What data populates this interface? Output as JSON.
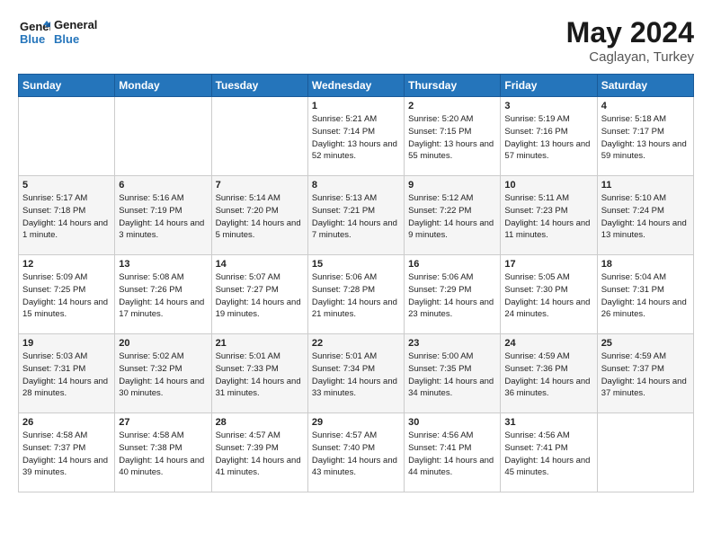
{
  "logo": {
    "line1": "General",
    "line2": "Blue"
  },
  "title": "May 2024",
  "location": "Caglayan, Turkey",
  "days_of_week": [
    "Sunday",
    "Monday",
    "Tuesday",
    "Wednesday",
    "Thursday",
    "Friday",
    "Saturday"
  ],
  "weeks": [
    [
      {
        "num": "",
        "info": ""
      },
      {
        "num": "",
        "info": ""
      },
      {
        "num": "",
        "info": ""
      },
      {
        "num": "1",
        "info": "Sunrise: 5:21 AM\nSunset: 7:14 PM\nDaylight: 13 hours\nand 52 minutes."
      },
      {
        "num": "2",
        "info": "Sunrise: 5:20 AM\nSunset: 7:15 PM\nDaylight: 13 hours\nand 55 minutes."
      },
      {
        "num": "3",
        "info": "Sunrise: 5:19 AM\nSunset: 7:16 PM\nDaylight: 13 hours\nand 57 minutes."
      },
      {
        "num": "4",
        "info": "Sunrise: 5:18 AM\nSunset: 7:17 PM\nDaylight: 13 hours\nand 59 minutes."
      }
    ],
    [
      {
        "num": "5",
        "info": "Sunrise: 5:17 AM\nSunset: 7:18 PM\nDaylight: 14 hours\nand 1 minute."
      },
      {
        "num": "6",
        "info": "Sunrise: 5:16 AM\nSunset: 7:19 PM\nDaylight: 14 hours\nand 3 minutes."
      },
      {
        "num": "7",
        "info": "Sunrise: 5:14 AM\nSunset: 7:20 PM\nDaylight: 14 hours\nand 5 minutes."
      },
      {
        "num": "8",
        "info": "Sunrise: 5:13 AM\nSunset: 7:21 PM\nDaylight: 14 hours\nand 7 minutes."
      },
      {
        "num": "9",
        "info": "Sunrise: 5:12 AM\nSunset: 7:22 PM\nDaylight: 14 hours\nand 9 minutes."
      },
      {
        "num": "10",
        "info": "Sunrise: 5:11 AM\nSunset: 7:23 PM\nDaylight: 14 hours\nand 11 minutes."
      },
      {
        "num": "11",
        "info": "Sunrise: 5:10 AM\nSunset: 7:24 PM\nDaylight: 14 hours\nand 13 minutes."
      }
    ],
    [
      {
        "num": "12",
        "info": "Sunrise: 5:09 AM\nSunset: 7:25 PM\nDaylight: 14 hours\nand 15 minutes."
      },
      {
        "num": "13",
        "info": "Sunrise: 5:08 AM\nSunset: 7:26 PM\nDaylight: 14 hours\nand 17 minutes."
      },
      {
        "num": "14",
        "info": "Sunrise: 5:07 AM\nSunset: 7:27 PM\nDaylight: 14 hours\nand 19 minutes."
      },
      {
        "num": "15",
        "info": "Sunrise: 5:06 AM\nSunset: 7:28 PM\nDaylight: 14 hours\nand 21 minutes."
      },
      {
        "num": "16",
        "info": "Sunrise: 5:06 AM\nSunset: 7:29 PM\nDaylight: 14 hours\nand 23 minutes."
      },
      {
        "num": "17",
        "info": "Sunrise: 5:05 AM\nSunset: 7:30 PM\nDaylight: 14 hours\nand 24 minutes."
      },
      {
        "num": "18",
        "info": "Sunrise: 5:04 AM\nSunset: 7:31 PM\nDaylight: 14 hours\nand 26 minutes."
      }
    ],
    [
      {
        "num": "19",
        "info": "Sunrise: 5:03 AM\nSunset: 7:31 PM\nDaylight: 14 hours\nand 28 minutes."
      },
      {
        "num": "20",
        "info": "Sunrise: 5:02 AM\nSunset: 7:32 PM\nDaylight: 14 hours\nand 30 minutes."
      },
      {
        "num": "21",
        "info": "Sunrise: 5:01 AM\nSunset: 7:33 PM\nDaylight: 14 hours\nand 31 minutes."
      },
      {
        "num": "22",
        "info": "Sunrise: 5:01 AM\nSunset: 7:34 PM\nDaylight: 14 hours\nand 33 minutes."
      },
      {
        "num": "23",
        "info": "Sunrise: 5:00 AM\nSunset: 7:35 PM\nDaylight: 14 hours\nand 34 minutes."
      },
      {
        "num": "24",
        "info": "Sunrise: 4:59 AM\nSunset: 7:36 PM\nDaylight: 14 hours\nand 36 minutes."
      },
      {
        "num": "25",
        "info": "Sunrise: 4:59 AM\nSunset: 7:37 PM\nDaylight: 14 hours\nand 37 minutes."
      }
    ],
    [
      {
        "num": "26",
        "info": "Sunrise: 4:58 AM\nSunset: 7:37 PM\nDaylight: 14 hours\nand 39 minutes."
      },
      {
        "num": "27",
        "info": "Sunrise: 4:58 AM\nSunset: 7:38 PM\nDaylight: 14 hours\nand 40 minutes."
      },
      {
        "num": "28",
        "info": "Sunrise: 4:57 AM\nSunset: 7:39 PM\nDaylight: 14 hours\nand 41 minutes."
      },
      {
        "num": "29",
        "info": "Sunrise: 4:57 AM\nSunset: 7:40 PM\nDaylight: 14 hours\nand 43 minutes."
      },
      {
        "num": "30",
        "info": "Sunrise: 4:56 AM\nSunset: 7:41 PM\nDaylight: 14 hours\nand 44 minutes."
      },
      {
        "num": "31",
        "info": "Sunrise: 4:56 AM\nSunset: 7:41 PM\nDaylight: 14 hours\nand 45 minutes."
      },
      {
        "num": "",
        "info": ""
      }
    ]
  ]
}
